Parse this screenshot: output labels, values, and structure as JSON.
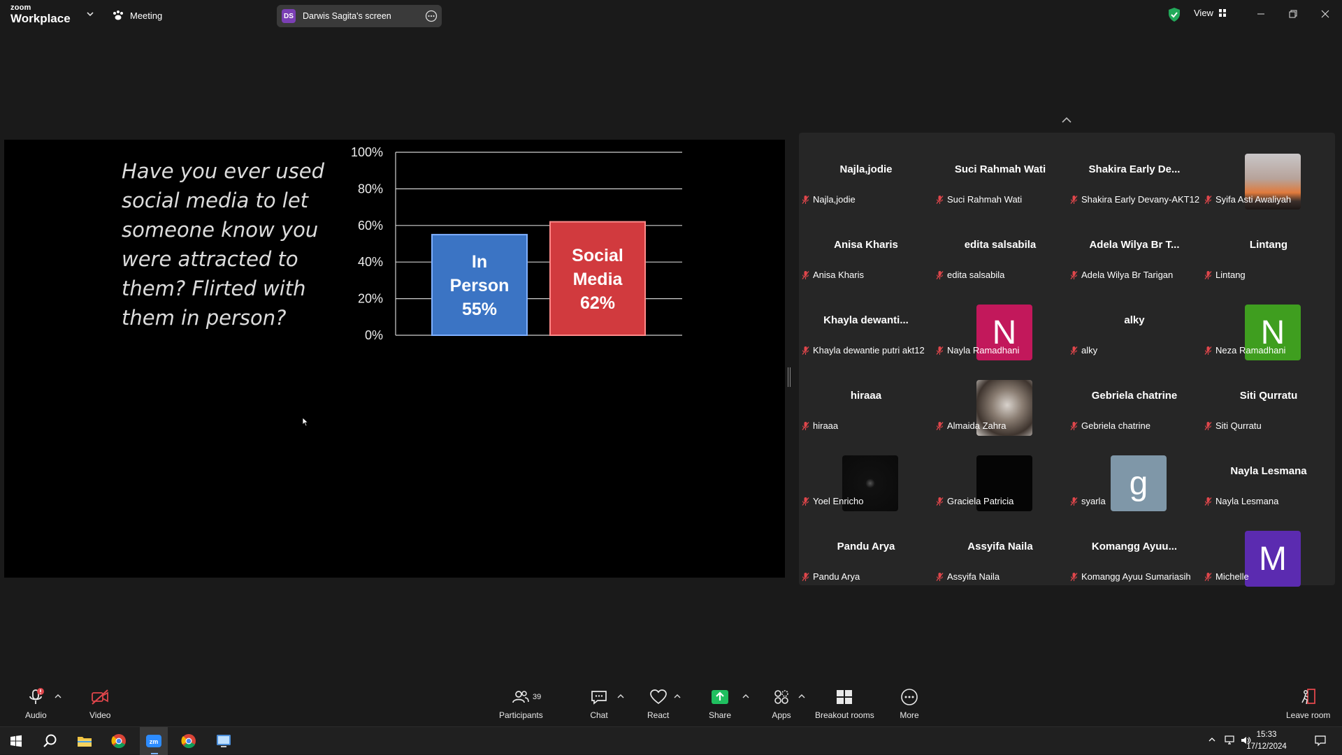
{
  "app": {
    "brand_line1": "zoom",
    "brand_line2": "Workplace",
    "meeting_label": "Meeting",
    "share_badge": "DS",
    "share_title": "Darwis Sagita's screen",
    "view_label": "View"
  },
  "colors": {
    "accent_green": "#22a95a",
    "bar_in_person": "#3b74c4",
    "bar_social": "#d13a3e",
    "mute_red": "#e0464b",
    "share_green": "#1fbf5f"
  },
  "slide": {
    "question": "Have you ever used social media to let someone know you were attracted to them? Flirted with them in person?"
  },
  "chart_data": {
    "type": "bar",
    "categories": [
      "In Person",
      "Social Media"
    ],
    "values": [
      55,
      62
    ],
    "bar_labels": [
      "In Person 55%",
      "Social Media 62%"
    ],
    "bar_label_lines": [
      [
        "In",
        "Person",
        "55%"
      ],
      [
        "Social",
        "Media",
        "62%"
      ]
    ],
    "bar_colors": [
      "#3b74c4",
      "#d13a3e"
    ],
    "yticks": [
      "0%",
      "20%",
      "40%",
      "60%",
      "80%",
      "100%"
    ],
    "ylim": [
      0,
      100
    ],
    "grid": true,
    "legend": "none",
    "title": "",
    "xlabel": "",
    "ylabel": ""
  },
  "participants": [
    {
      "display": "Najla,jodie",
      "label": "Najla,jodie",
      "avatar": "name"
    },
    {
      "display": "Suci Rahmah Wati",
      "label": "Suci Rahmah Wati",
      "avatar": "name"
    },
    {
      "display": "Shakira  Early  De...",
      "label": "Shakira Early Devany-AKT12",
      "avatar": "name"
    },
    {
      "display": "",
      "label": "Syifa Asti Awaliyah",
      "avatar": "photo-sunset"
    },
    {
      "display": "Anisa Kharis",
      "label": "Anisa Kharis",
      "avatar": "name"
    },
    {
      "display": "edita salsabila",
      "label": "edita salsabila",
      "avatar": "name"
    },
    {
      "display": "Adela Wilya Br T...",
      "label": "Adela Wilya Br Tarigan",
      "avatar": "name"
    },
    {
      "display": "Lintang",
      "label": "Lintang",
      "avatar": "name"
    },
    {
      "display": "Khayla  dewanti...",
      "label": "Khayla dewantie putri akt12",
      "avatar": "name"
    },
    {
      "display": "N",
      "label": "Nayla Ramadhani",
      "avatar": "letter",
      "color": "#c2185b"
    },
    {
      "display": "alky",
      "label": "alky",
      "avatar": "name"
    },
    {
      "display": "N",
      "label": "Neza Ramadhani",
      "avatar": "letter",
      "color": "#3f9e1f"
    },
    {
      "display": "hiraaa",
      "label": "hiraaa",
      "avatar": "name"
    },
    {
      "display": "",
      "label": "Almaida Zahra",
      "avatar": "photo-cat"
    },
    {
      "display": "Gebriela chatrine",
      "label": "Gebriela chatrine",
      "avatar": "name"
    },
    {
      "display": "Siti Qurratu",
      "label": "Siti Qurratu",
      "avatar": "name"
    },
    {
      "display": "",
      "label": "Yoel Enricho",
      "avatar": "photo-dark"
    },
    {
      "display": "",
      "label": "Graciela Patricia",
      "avatar": "photo-black"
    },
    {
      "display": "g",
      "label": "syarla",
      "avatar": "letter",
      "color": "#7f97a8"
    },
    {
      "display": "Nayla Lesmana",
      "label": "Nayla Lesmana",
      "avatar": "name"
    },
    {
      "display": "Pandu Arya",
      "label": "Pandu Arya",
      "avatar": "name"
    },
    {
      "display": "Assyifa Naila",
      "label": "Assyifa Naila",
      "avatar": "name"
    },
    {
      "display": "Komangg  Ayuu...",
      "label": "Komangg Ayuu Sumariasih",
      "avatar": "name"
    },
    {
      "display": "M",
      "label": "Michelle",
      "avatar": "letter",
      "color": "#5b2bb0"
    }
  ],
  "toolbar": {
    "audio": "Audio",
    "video": "Video",
    "participants": "Participants",
    "participants_count": "39",
    "chat": "Chat",
    "react": "React",
    "share": "Share",
    "apps": "Apps",
    "breakout": "Breakout rooms",
    "more": "More",
    "leave": "Leave room"
  },
  "taskbar": {
    "time": "15:33",
    "date": "17/12/2024"
  }
}
